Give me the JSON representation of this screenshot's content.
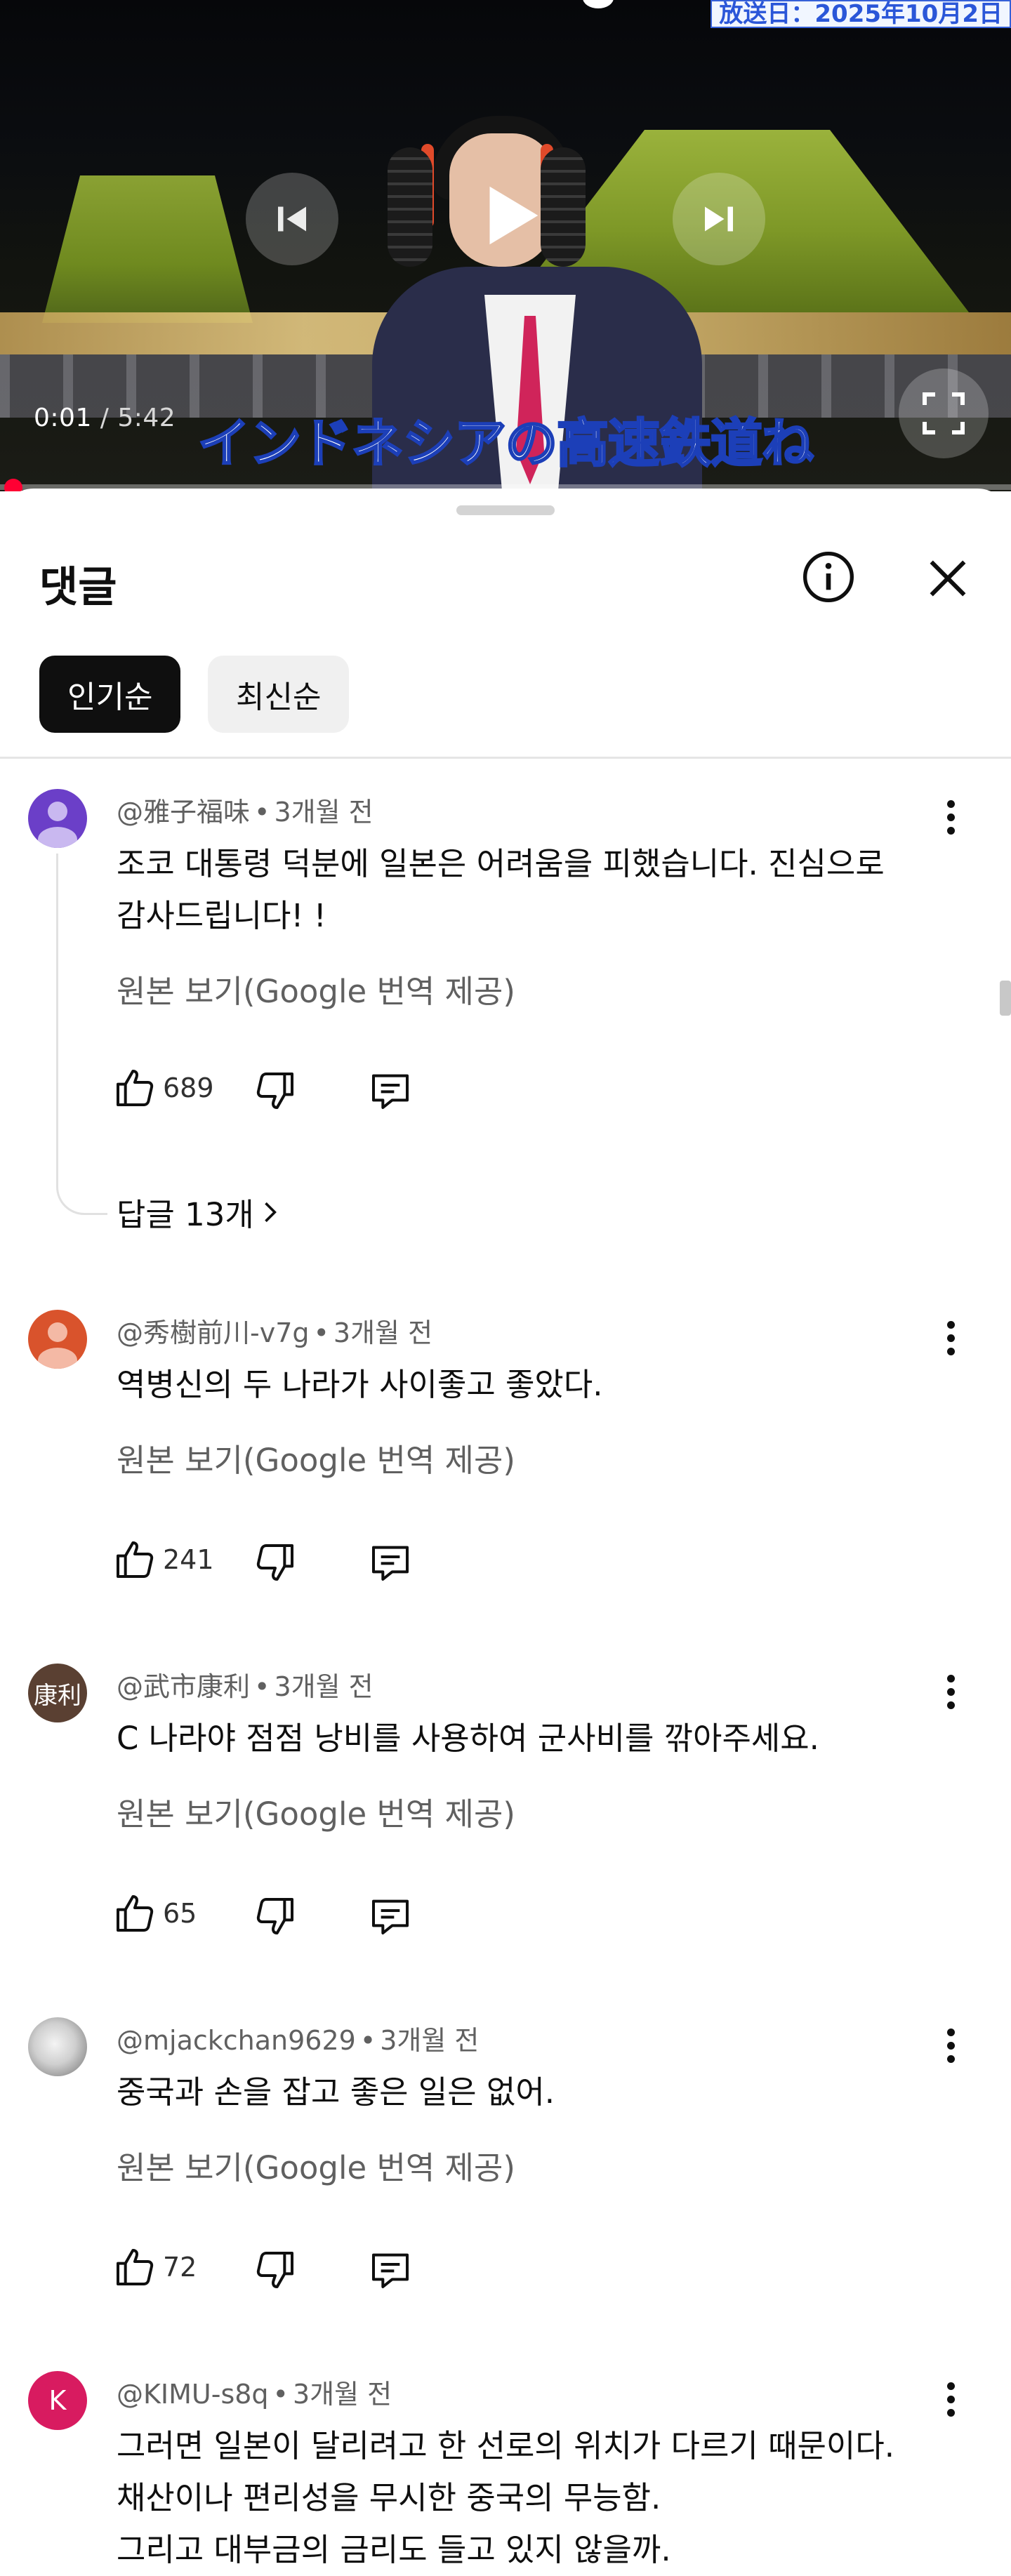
{
  "player": {
    "broadcast_label": "放送日：2025年10月2日",
    "time_current": "0:01",
    "time_separator": " / ",
    "time_total": "5:42",
    "subtitle": "インドネシアの高速鉄道ね",
    "progress_fraction": 0.003,
    "accent_color": "#ff0033"
  },
  "sheet": {
    "title": "댓글",
    "info_icon": "info-icon",
    "close_icon": "close-icon",
    "chips": [
      {
        "label": "인기순",
        "selected": true
      },
      {
        "label": "최신순",
        "selected": false
      }
    ]
  },
  "comments": [
    {
      "author": "@雅子福味",
      "time": "3개월 전",
      "avatar_text": "",
      "avatar_color": "#6b3fc8",
      "text_lines": [
        "조코 대통령 덕분에 일본은 어려움을 피했습니다. 진심으로",
        "감사드립니다! !"
      ],
      "translate_label": "원본 보기(Google 번역 제공)",
      "likes": "689",
      "replies_label": "답글 13개"
    },
    {
      "author": "@秀樹前川-v7g",
      "time": "3개월 전",
      "avatar_text": "",
      "avatar_color": "#d9532c",
      "text_lines": [
        "역병신의 두 나라가 사이좋고 좋았다."
      ],
      "translate_label": "원본 보기(Google 번역 제공)",
      "likes": "241"
    },
    {
      "author": "@武市康利",
      "time": "3개월 전",
      "avatar_text": "康利",
      "avatar_color": "#5a4032",
      "text_lines": [
        "C 나라야 점점 낭비를 사용하여 군사비를 깎아주세요."
      ],
      "translate_label": "원본 보기(Google 번역 제공)",
      "likes": "65"
    },
    {
      "author": "@mjackchan9629",
      "time": "3개월 전",
      "avatar_text": "",
      "avatar_color": "#bdbdbd",
      "text_lines": [
        "중국과 손을 잡고 좋은 일은 없어."
      ],
      "translate_label": "원본 보기(Google 번역 제공)",
      "likes": "72"
    },
    {
      "author": "@KIMU-s8q",
      "time": "3개월 전",
      "avatar_text": "K",
      "avatar_color": "#d81b60",
      "text_lines": [
        "그러면 일본이 달리려고 한 선로의 위치가 다르기 때문이다.",
        "채산이나 편리성을 무시한 중국의 무능함.",
        "그리고 대부금의 금리도 들고 있지 않을까."
      ]
    }
  ],
  "meta_separator": "•"
}
